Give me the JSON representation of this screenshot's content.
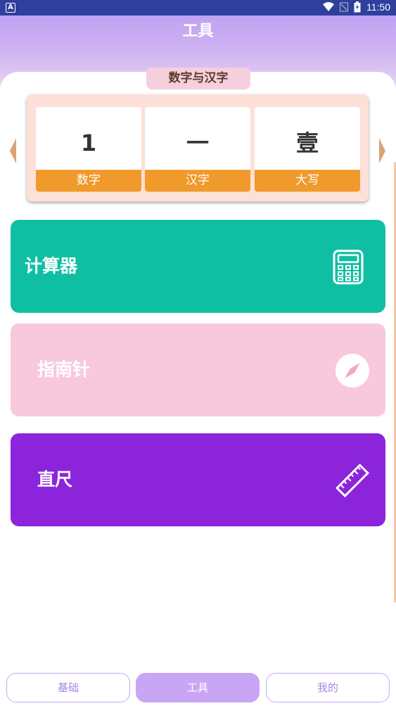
{
  "status_bar": {
    "time": "11:50",
    "app_icon_letter": "A"
  },
  "header": {
    "title": "工具"
  },
  "converter": {
    "section_label": "数字与汉字",
    "cells": [
      {
        "value": "1",
        "label": "数字"
      },
      {
        "value": "一",
        "label": "汉字"
      },
      {
        "value": "壹",
        "label": "大写"
      }
    ]
  },
  "tools": [
    {
      "name": "计算器",
      "icon": "calculator-icon",
      "color": "#0fbfa3"
    },
    {
      "name": "指南针",
      "icon": "compass-icon",
      "color": "#f8c9dc"
    },
    {
      "name": "直尺",
      "icon": "ruler-icon",
      "color": "#8c24db"
    }
  ],
  "bottom_nav": {
    "tabs": [
      {
        "label": "基础"
      },
      {
        "label": "工具"
      },
      {
        "label": "我的"
      }
    ],
    "active": "工具"
  },
  "colors": {
    "accent_orange": "#f09a2b",
    "nav_purple": "#c9a6f5",
    "header_purple": "#b99af3"
  }
}
